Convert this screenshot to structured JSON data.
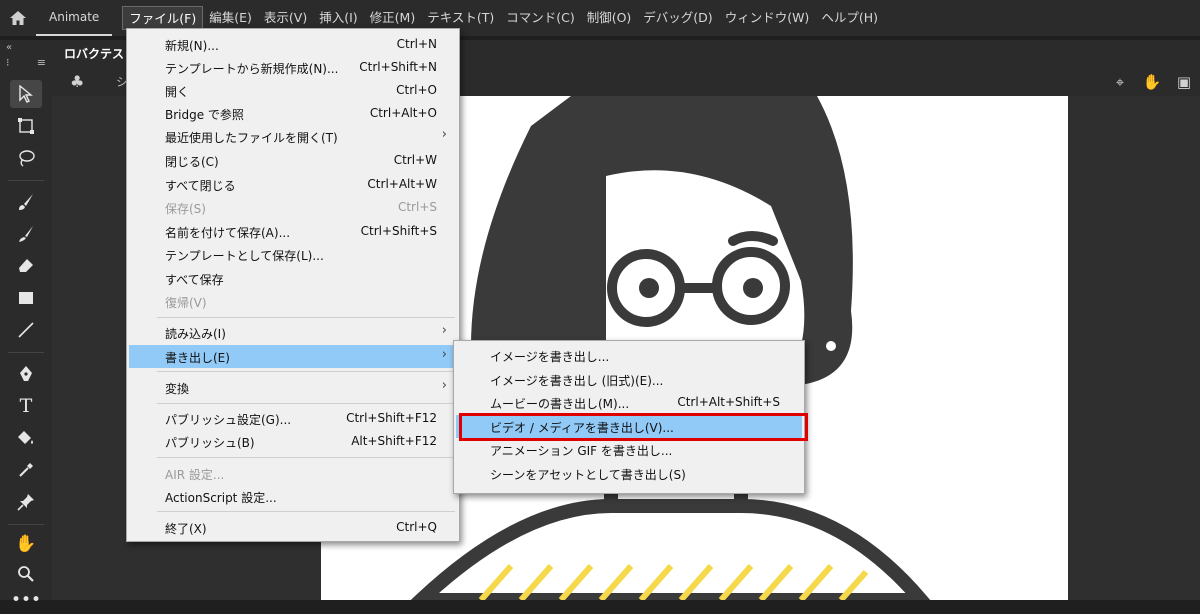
{
  "menubar": {
    "app_name": "Animate",
    "items": [
      "ファイル(F)",
      "編集(E)",
      "表示(V)",
      "挿入(I)",
      "修正(M)",
      "テキスト(T)",
      "コマンド(C)",
      "制御(O)",
      "デバッグ(D)",
      "ウィンドウ(W)",
      "ヘルプ(H)"
    ]
  },
  "document": {
    "tab_title": "ロバクテスト",
    "scene_label": "シ"
  },
  "file_menu": {
    "items": [
      {
        "label": "新規(N)...",
        "shortcut": "Ctrl+N"
      },
      {
        "label": "テンプレートから新規作成(N)...",
        "shortcut": "Ctrl+Shift+N"
      },
      {
        "label": "開く",
        "shortcut": "Ctrl+O"
      },
      {
        "label": "Bridge で参照",
        "shortcut": "Ctrl+Alt+O"
      },
      {
        "label": "最近使用したファイルを開く(T)",
        "shortcut": ""
      },
      {
        "label": "閉じる(C)",
        "shortcut": "Ctrl+W"
      },
      {
        "label": "すべて閉じる",
        "shortcut": "Ctrl+Alt+W"
      },
      {
        "label": "保存(S)",
        "shortcut": "Ctrl+S"
      },
      {
        "label": "名前を付けて保存(A)...",
        "shortcut": "Ctrl+Shift+S"
      },
      {
        "label": "テンプレートとして保存(L)...",
        "shortcut": ""
      },
      {
        "label": "すべて保存",
        "shortcut": ""
      },
      {
        "label": "復帰(V)",
        "shortcut": ""
      },
      {
        "label": "読み込み(I)",
        "shortcut": ""
      },
      {
        "label": "書き出し(E)",
        "shortcut": ""
      },
      {
        "label": "変換",
        "shortcut": ""
      },
      {
        "label": "パブリッシュ設定(G)...",
        "shortcut": "Ctrl+Shift+F12"
      },
      {
        "label": "パブリッシュ(B)",
        "shortcut": "Alt+Shift+F12"
      },
      {
        "label": "AIR 設定...",
        "shortcut": ""
      },
      {
        "label": "ActionScript 設定...",
        "shortcut": ""
      },
      {
        "label": "終了(X)",
        "shortcut": "Ctrl+Q"
      }
    ]
  },
  "export_submenu": {
    "items": [
      {
        "label": "イメージを書き出し...",
        "shortcut": ""
      },
      {
        "label": "イメージを書き出し (旧式)(E)...",
        "shortcut": ""
      },
      {
        "label": "ムービーの書き出し(M)...",
        "shortcut": "Ctrl+Alt+Shift+S"
      },
      {
        "label": "ビデオ / メディアを書き出し(V)...",
        "shortcut": ""
      },
      {
        "label": "アニメーション GIF を書き出し...",
        "shortcut": ""
      },
      {
        "label": "シーンをアセットとして書き出し(S)",
        "shortcut": ""
      }
    ]
  },
  "colors": {
    "highlight": "#91c9f7",
    "callout": "#e00000",
    "stripes": "#f5d94a",
    "ink": "#3a3a3a"
  }
}
